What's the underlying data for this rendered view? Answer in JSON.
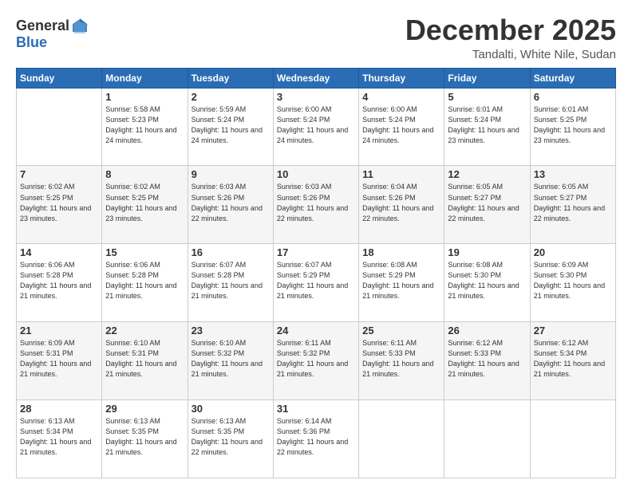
{
  "header": {
    "logo_general": "General",
    "logo_blue": "Blue",
    "month": "December 2025",
    "location": "Tandalti, White Nile, Sudan"
  },
  "days_of_week": [
    "Sunday",
    "Monday",
    "Tuesday",
    "Wednesday",
    "Thursday",
    "Friday",
    "Saturday"
  ],
  "weeks": [
    [
      {
        "day": "",
        "sunrise": "",
        "sunset": "",
        "daylight": ""
      },
      {
        "day": "1",
        "sunrise": "Sunrise: 5:58 AM",
        "sunset": "Sunset: 5:23 PM",
        "daylight": "Daylight: 11 hours and 24 minutes."
      },
      {
        "day": "2",
        "sunrise": "Sunrise: 5:59 AM",
        "sunset": "Sunset: 5:24 PM",
        "daylight": "Daylight: 11 hours and 24 minutes."
      },
      {
        "day": "3",
        "sunrise": "Sunrise: 6:00 AM",
        "sunset": "Sunset: 5:24 PM",
        "daylight": "Daylight: 11 hours and 24 minutes."
      },
      {
        "day": "4",
        "sunrise": "Sunrise: 6:00 AM",
        "sunset": "Sunset: 5:24 PM",
        "daylight": "Daylight: 11 hours and 24 minutes."
      },
      {
        "day": "5",
        "sunrise": "Sunrise: 6:01 AM",
        "sunset": "Sunset: 5:24 PM",
        "daylight": "Daylight: 11 hours and 23 minutes."
      },
      {
        "day": "6",
        "sunrise": "Sunrise: 6:01 AM",
        "sunset": "Sunset: 5:25 PM",
        "daylight": "Daylight: 11 hours and 23 minutes."
      }
    ],
    [
      {
        "day": "7",
        "sunrise": "Sunrise: 6:02 AM",
        "sunset": "Sunset: 5:25 PM",
        "daylight": "Daylight: 11 hours and 23 minutes."
      },
      {
        "day": "8",
        "sunrise": "Sunrise: 6:02 AM",
        "sunset": "Sunset: 5:25 PM",
        "daylight": "Daylight: 11 hours and 23 minutes."
      },
      {
        "day": "9",
        "sunrise": "Sunrise: 6:03 AM",
        "sunset": "Sunset: 5:26 PM",
        "daylight": "Daylight: 11 hours and 22 minutes."
      },
      {
        "day": "10",
        "sunrise": "Sunrise: 6:03 AM",
        "sunset": "Sunset: 5:26 PM",
        "daylight": "Daylight: 11 hours and 22 minutes."
      },
      {
        "day": "11",
        "sunrise": "Sunrise: 6:04 AM",
        "sunset": "Sunset: 5:26 PM",
        "daylight": "Daylight: 11 hours and 22 minutes."
      },
      {
        "day": "12",
        "sunrise": "Sunrise: 6:05 AM",
        "sunset": "Sunset: 5:27 PM",
        "daylight": "Daylight: 11 hours and 22 minutes."
      },
      {
        "day": "13",
        "sunrise": "Sunrise: 6:05 AM",
        "sunset": "Sunset: 5:27 PM",
        "daylight": "Daylight: 11 hours and 22 minutes."
      }
    ],
    [
      {
        "day": "14",
        "sunrise": "Sunrise: 6:06 AM",
        "sunset": "Sunset: 5:28 PM",
        "daylight": "Daylight: 11 hours and 21 minutes."
      },
      {
        "day": "15",
        "sunrise": "Sunrise: 6:06 AM",
        "sunset": "Sunset: 5:28 PM",
        "daylight": "Daylight: 11 hours and 21 minutes."
      },
      {
        "day": "16",
        "sunrise": "Sunrise: 6:07 AM",
        "sunset": "Sunset: 5:28 PM",
        "daylight": "Daylight: 11 hours and 21 minutes."
      },
      {
        "day": "17",
        "sunrise": "Sunrise: 6:07 AM",
        "sunset": "Sunset: 5:29 PM",
        "daylight": "Daylight: 11 hours and 21 minutes."
      },
      {
        "day": "18",
        "sunrise": "Sunrise: 6:08 AM",
        "sunset": "Sunset: 5:29 PM",
        "daylight": "Daylight: 11 hours and 21 minutes."
      },
      {
        "day": "19",
        "sunrise": "Sunrise: 6:08 AM",
        "sunset": "Sunset: 5:30 PM",
        "daylight": "Daylight: 11 hours and 21 minutes."
      },
      {
        "day": "20",
        "sunrise": "Sunrise: 6:09 AM",
        "sunset": "Sunset: 5:30 PM",
        "daylight": "Daylight: 11 hours and 21 minutes."
      }
    ],
    [
      {
        "day": "21",
        "sunrise": "Sunrise: 6:09 AM",
        "sunset": "Sunset: 5:31 PM",
        "daylight": "Daylight: 11 hours and 21 minutes."
      },
      {
        "day": "22",
        "sunrise": "Sunrise: 6:10 AM",
        "sunset": "Sunset: 5:31 PM",
        "daylight": "Daylight: 11 hours and 21 minutes."
      },
      {
        "day": "23",
        "sunrise": "Sunrise: 6:10 AM",
        "sunset": "Sunset: 5:32 PM",
        "daylight": "Daylight: 11 hours and 21 minutes."
      },
      {
        "day": "24",
        "sunrise": "Sunrise: 6:11 AM",
        "sunset": "Sunset: 5:32 PM",
        "daylight": "Daylight: 11 hours and 21 minutes."
      },
      {
        "day": "25",
        "sunrise": "Sunrise: 6:11 AM",
        "sunset": "Sunset: 5:33 PM",
        "daylight": "Daylight: 11 hours and 21 minutes."
      },
      {
        "day": "26",
        "sunrise": "Sunrise: 6:12 AM",
        "sunset": "Sunset: 5:33 PM",
        "daylight": "Daylight: 11 hours and 21 minutes."
      },
      {
        "day": "27",
        "sunrise": "Sunrise: 6:12 AM",
        "sunset": "Sunset: 5:34 PM",
        "daylight": "Daylight: 11 hours and 21 minutes."
      }
    ],
    [
      {
        "day": "28",
        "sunrise": "Sunrise: 6:13 AM",
        "sunset": "Sunset: 5:34 PM",
        "daylight": "Daylight: 11 hours and 21 minutes."
      },
      {
        "day": "29",
        "sunrise": "Sunrise: 6:13 AM",
        "sunset": "Sunset: 5:35 PM",
        "daylight": "Daylight: 11 hours and 21 minutes."
      },
      {
        "day": "30",
        "sunrise": "Sunrise: 6:13 AM",
        "sunset": "Sunset: 5:35 PM",
        "daylight": "Daylight: 11 hours and 22 minutes."
      },
      {
        "day": "31",
        "sunrise": "Sunrise: 6:14 AM",
        "sunset": "Sunset: 5:36 PM",
        "daylight": "Daylight: 11 hours and 22 minutes."
      },
      {
        "day": "",
        "sunrise": "",
        "sunset": "",
        "daylight": ""
      },
      {
        "day": "",
        "sunrise": "",
        "sunset": "",
        "daylight": ""
      },
      {
        "day": "",
        "sunrise": "",
        "sunset": "",
        "daylight": ""
      }
    ]
  ]
}
